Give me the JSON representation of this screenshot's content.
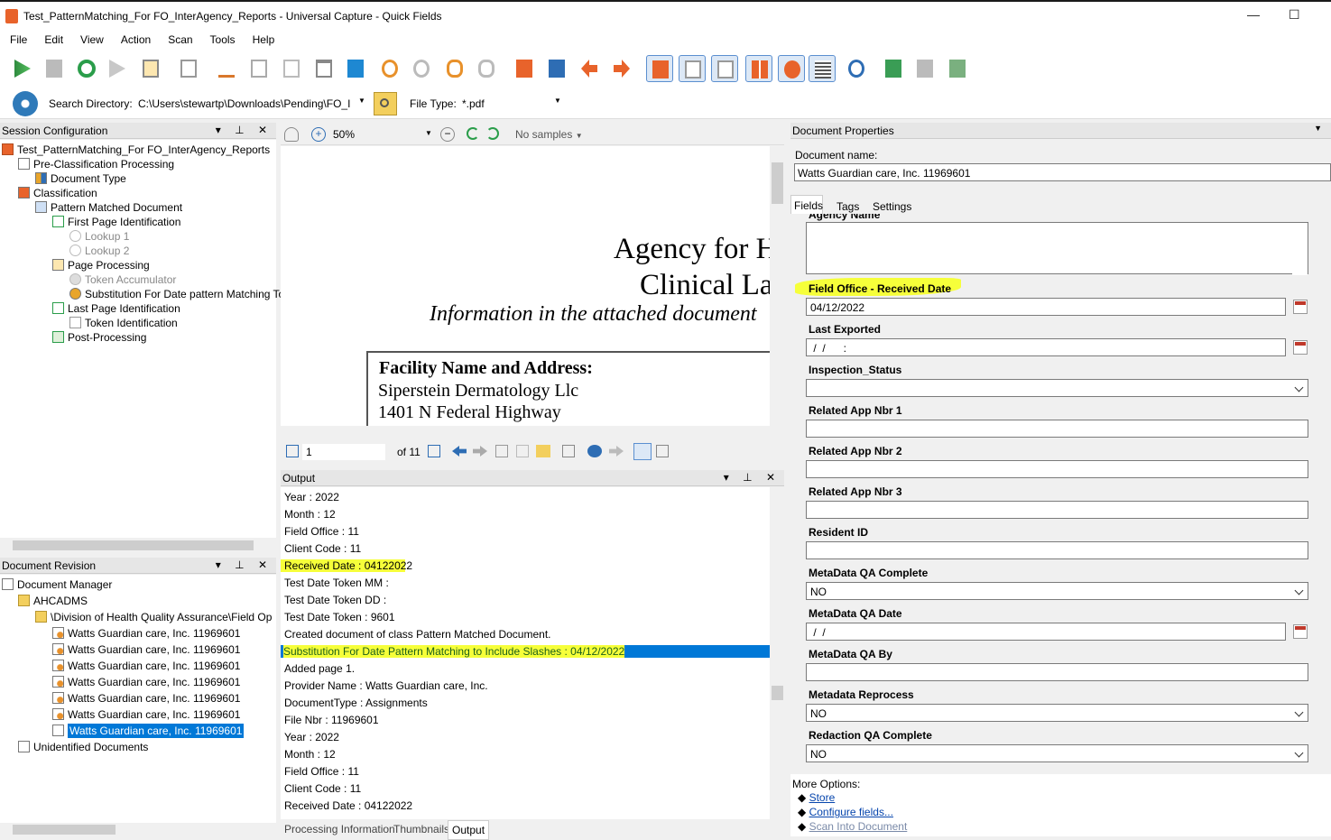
{
  "window": {
    "title": "Test_PatternMatching_For FO_InterAgency_Reports - Universal Capture - Quick Fields",
    "minimize": "—",
    "maximize": "☐"
  },
  "menu": [
    "File",
    "Edit",
    "View",
    "Action",
    "Scan",
    "Tools",
    "Help"
  ],
  "search": {
    "label": "Search Directory:",
    "path": "C:\\Users\\stewartp\\Downloads\\Pending\\FO_I",
    "filetype_label": "File Type:",
    "filetype": "*.pdf"
  },
  "session": {
    "header": "Session Configuration",
    "controls": "▾ ⊥ ✕",
    "nodes": [
      {
        "label": "Test_PatternMatching_For FO_InterAgency_Reports",
        "dim": false
      },
      {
        "label": "Pre-Classification Processing",
        "dim": false
      },
      {
        "label": "Document Type",
        "dim": false
      },
      {
        "label": "Classification",
        "dim": false
      },
      {
        "label": "Pattern Matched Document",
        "dim": false
      },
      {
        "label": "First Page Identification",
        "dim": false
      },
      {
        "label": "Lookup 1",
        "dim": true
      },
      {
        "label": "Lookup 2",
        "dim": true
      },
      {
        "label": "Page Processing",
        "dim": false
      },
      {
        "label": "Token Accumulator",
        "dim": true
      },
      {
        "label": "Substitution For Date pattern Matching Toke",
        "dim": false
      },
      {
        "label": "Last Page Identification",
        "dim": false
      },
      {
        "label": "Token Identification",
        "dim": false
      },
      {
        "label": "Post-Processing",
        "dim": false
      }
    ]
  },
  "revision": {
    "header": "Document Revision",
    "controls": "▾ ⊥ ✕",
    "nodes": [
      {
        "label": "Document Manager"
      },
      {
        "label": "AHCADMS"
      },
      {
        "label": "\\Division of Health Quality Assurance\\Field Op"
      },
      {
        "label": "Watts Guardian care, Inc. 11969601"
      },
      {
        "label": "Watts Guardian care, Inc. 11969601"
      },
      {
        "label": "Watts Guardian care, Inc. 11969601"
      },
      {
        "label": "Watts Guardian care, Inc. 11969601"
      },
      {
        "label": "Watts Guardian care, Inc. 11969601"
      },
      {
        "label": "Watts Guardian care, Inc. 11969601"
      },
      {
        "label": "Watts Guardian care, Inc. 11969601"
      },
      {
        "label": "Unidentified Documents"
      }
    ]
  },
  "viewer": {
    "zoom": "50%",
    "samples": "No samples",
    "page": "1",
    "of": "of 11",
    "doc": {
      "line1": "Agency for H",
      "line2": "Clinical La",
      "line3": "Information in the attached document",
      "box_title": "Facility Name and Address:",
      "box_line1": "Siperstein Dermatology Llc",
      "box_line2": "1401 N Federal Highway"
    }
  },
  "output": {
    "header": "Output",
    "controls": "▾ ⊥ ✕",
    "lines": [
      "Year : 2022",
      "Month : 12",
      "Field Office : 11",
      "Client Code : 11",
      "Received Date : 04122022",
      "Test Date Token MM  :",
      "Test Date Token DD :",
      "Test Date Token  : 9601",
      "Created document of class Pattern Matched Document.",
      "Substitution For Date Pattern Matching to Include Slashes : 04/12/2022",
      "Added page 1.",
      "Provider Name : Watts Guardian care, Inc.",
      "DocumentType : Assignments",
      "File Nbr : 11969601",
      "Year : 2022",
      "Month : 12",
      "Field Office : 11",
      "Client Code : 11",
      "Received Date : 04122022"
    ],
    "tabs": [
      "Processing Information",
      "Thumbnails",
      "Output"
    ]
  },
  "props": {
    "header": "Document Properties",
    "doc_name_label": "Document name:",
    "doc_name": "Watts Guardian care, Inc. 11969601",
    "tabs": [
      "Fields",
      "Tags",
      "Settings"
    ],
    "agency_label": "Agency Name",
    "fields": [
      {
        "label": "Field Office - Received Date",
        "value": "04/12/2022",
        "type": "date"
      },
      {
        "label": "Last Exported",
        "value": " /  /      :",
        "type": "date"
      },
      {
        "label": "Inspection_Status",
        "value": "",
        "type": "select"
      },
      {
        "label": "Related App Nbr 1",
        "value": "",
        "type": "text"
      },
      {
        "label": "Related App Nbr 2",
        "value": "",
        "type": "text"
      },
      {
        "label": "Related App Nbr 3",
        "value": "",
        "type": "text"
      },
      {
        "label": "Resident ID",
        "value": "",
        "type": "text"
      },
      {
        "label": "MetaData QA Complete",
        "value": "NO",
        "type": "select"
      },
      {
        "label": "MetaData QA Date",
        "value": " /  /",
        "type": "date"
      },
      {
        "label": "MetaData QA By",
        "value": "",
        "type": "text"
      },
      {
        "label": "Metadata Reprocess",
        "value": "NO",
        "type": "select"
      },
      {
        "label": "Redaction QA Complete",
        "value": "NO",
        "type": "select"
      }
    ],
    "more_options": "More Options:",
    "links": [
      "Store",
      "Configure fields...",
      "Scan Into Document"
    ]
  }
}
